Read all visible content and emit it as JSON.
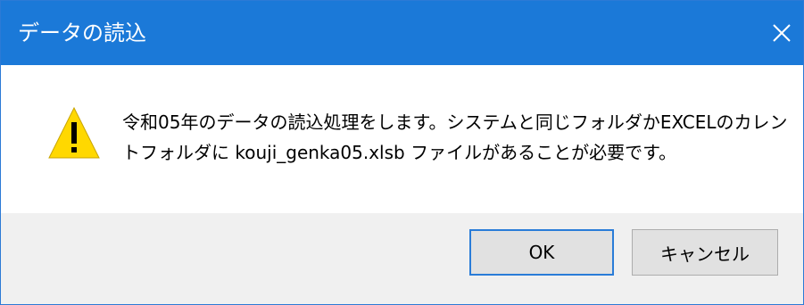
{
  "dialog": {
    "title": "データの読込",
    "message_lines": [
      "令和05年のデータの読込処理をします。システムと同じフォルダかEXCELのカレン",
      "トフォルダに kouji_genka05.xlsb ファイルがあることが必要です。"
    ],
    "icon": "warning-icon",
    "buttons": {
      "ok_label": "OK",
      "cancel_label": "キャンセル"
    }
  },
  "colors": {
    "titlebar": "#1b79d8",
    "footer": "#f0f0f0",
    "warning_fill": "#ffd800",
    "focus_border": "#2a7cd8"
  }
}
